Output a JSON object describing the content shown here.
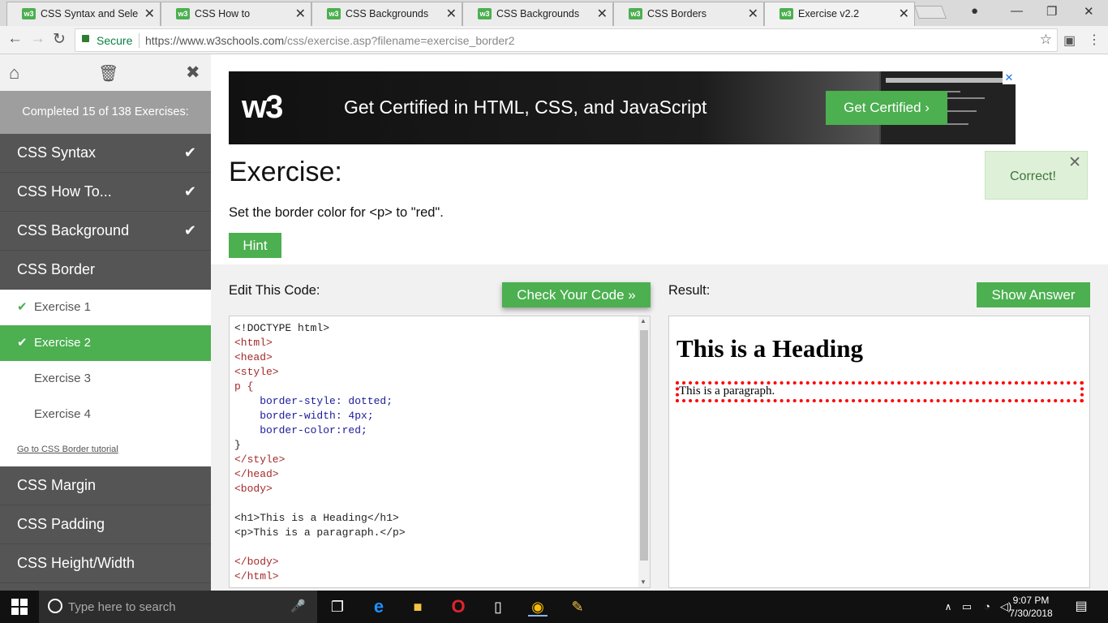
{
  "browser": {
    "tabs": [
      {
        "title": "CSS Syntax and Selector"
      },
      {
        "title": "CSS How to"
      },
      {
        "title": "CSS Backgrounds"
      },
      {
        "title": "CSS Backgrounds"
      },
      {
        "title": "CSS Borders"
      },
      {
        "title": "Exercise v2.2",
        "active": true
      }
    ],
    "favicon_text": "w3",
    "address": {
      "secure_label": "Secure",
      "url_host": "https://www.w3schools.com",
      "url_path": "/css/exercise.asp?filename=exercise_border2"
    }
  },
  "sidebar": {
    "progress": "Completed 15 of 138 Exercises:",
    "categories_top": [
      {
        "label": "CSS Syntax",
        "done": true
      },
      {
        "label": "CSS How To...",
        "done": true
      },
      {
        "label": "CSS Background",
        "done": true
      },
      {
        "label": "CSS Border",
        "done": false
      }
    ],
    "subitems": [
      {
        "label": "Exercise 1",
        "done": true
      },
      {
        "label": "Exercise 2",
        "done": true,
        "active": true
      },
      {
        "label": "Exercise 3",
        "done": false
      },
      {
        "label": "Exercise 4",
        "done": false
      }
    ],
    "tutorial_link": "Go to CSS Border tutorial",
    "categories_bottom": [
      {
        "label": "CSS Margin"
      },
      {
        "label": "CSS Padding"
      },
      {
        "label": "CSS Height/Width"
      }
    ]
  },
  "ad": {
    "logo": "w3",
    "headline": "Get Certified in HTML, CSS, and JavaScript",
    "cta": "Get Certified ›"
  },
  "exercise": {
    "title": "Exercise:",
    "instruction": "Set the border color for <p> to \"red\".",
    "hint": "Hint",
    "toast": "Correct!",
    "edit_label": "Edit This Code:",
    "check_button": "Check Your Code »",
    "result_label": "Result:",
    "show_answer_button": "Show Answer",
    "result_heading": "This is a Heading",
    "result_paragraph": "This is a paragraph."
  },
  "code_lines": [
    "<!DOCTYPE html>",
    "<html>",
    "<head>",
    "<style>",
    "p {",
    "    border-style: dotted;",
    "    border-width: 4px;",
    "    border-color:red;",
    "}",
    "</style>",
    "</head>",
    "<body>",
    "",
    "<h1>This is a Heading</h1>",
    "<p>This is a paragraph.</p>",
    "",
    "</body>",
    "</html>"
  ],
  "taskbar": {
    "search_placeholder": "Type here to search",
    "time": "9:07 PM",
    "date": "7/30/2018"
  },
  "colors": {
    "accent": "#4caf50",
    "sidebar": "#555555",
    "error_border": "#ff0000"
  }
}
